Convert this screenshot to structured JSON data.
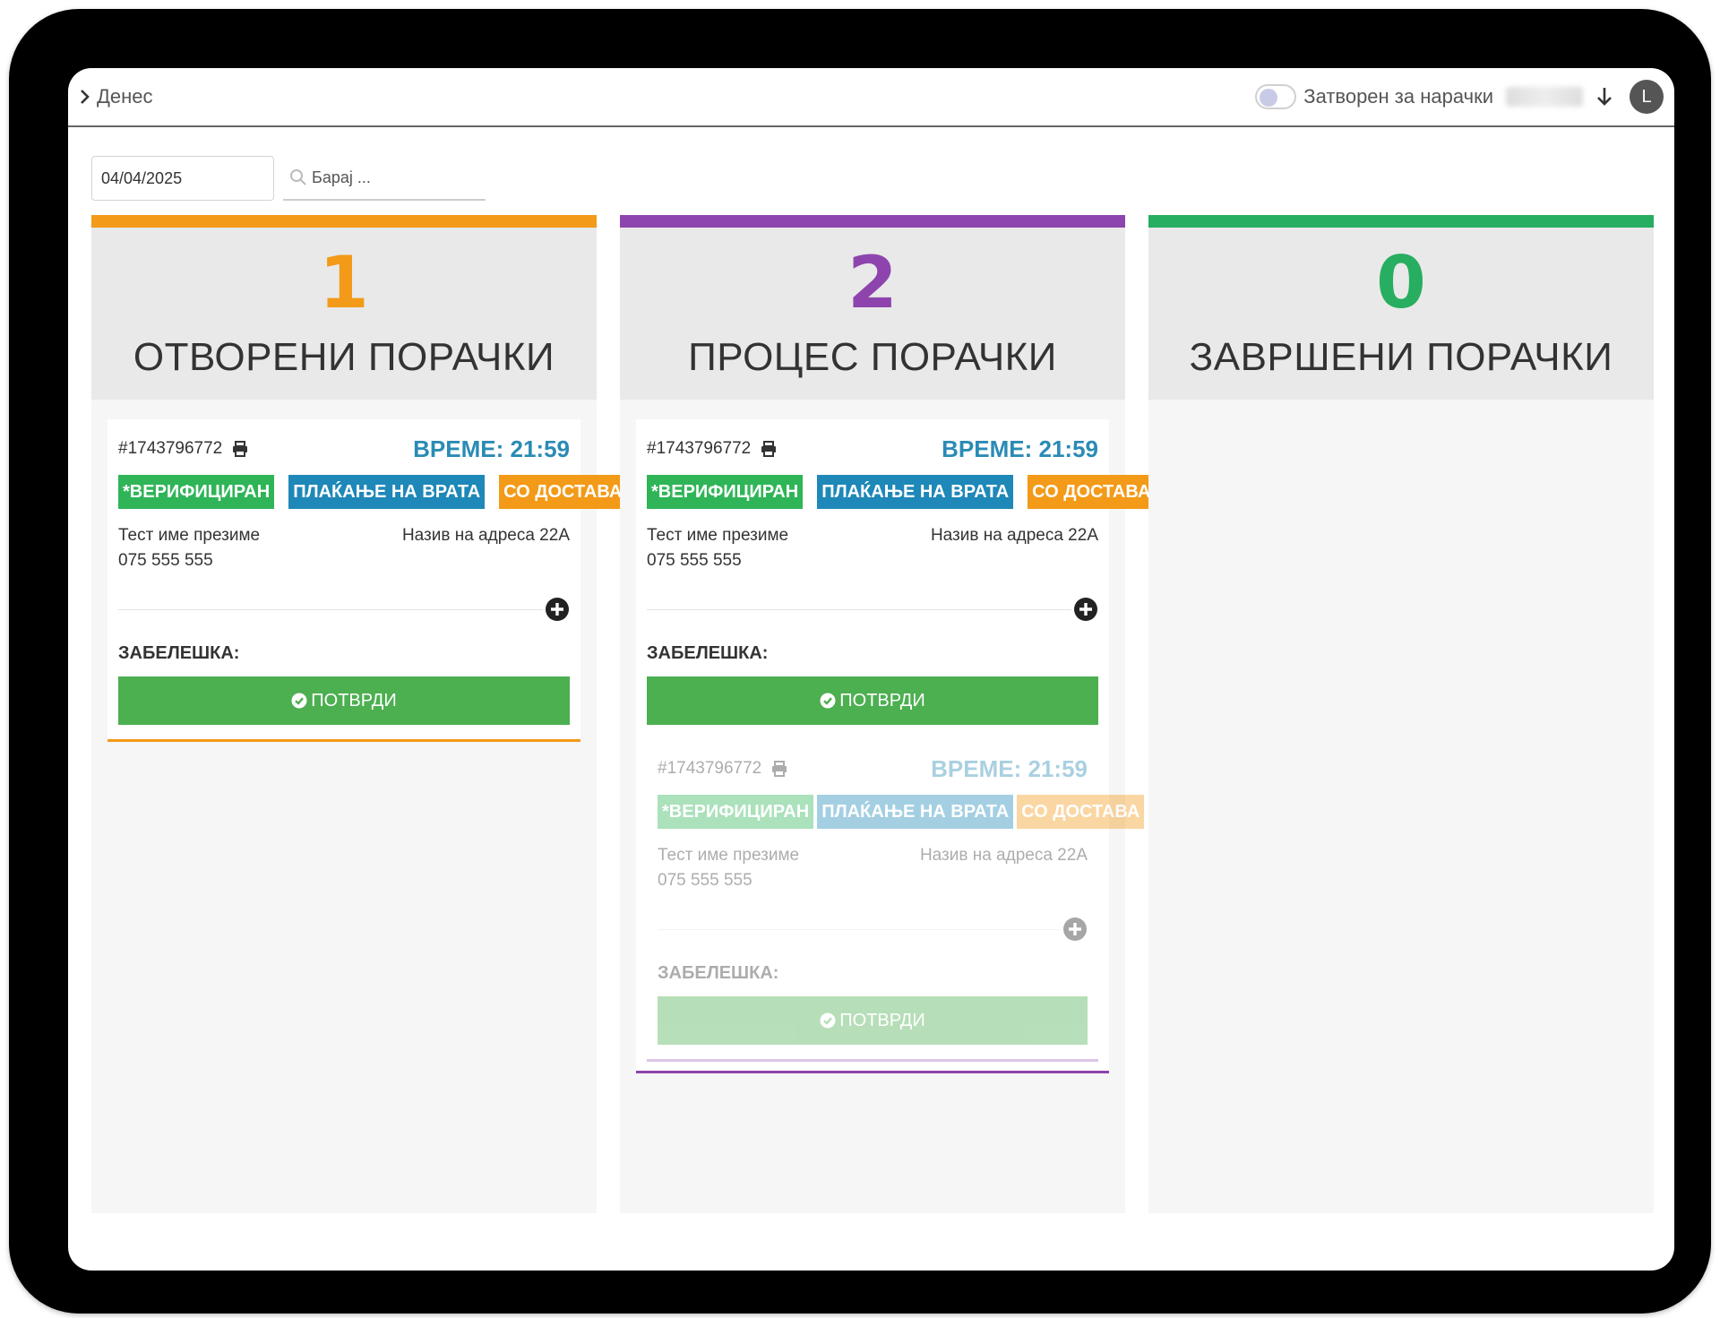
{
  "topbar": {
    "title": "Денес",
    "closed_label": "Затворен за нарачки",
    "avatar_letter": "L"
  },
  "filters": {
    "date_value": "04/04/2025",
    "search_placeholder": "Барај ..."
  },
  "columns": [
    {
      "count": "1",
      "title": "ОТВОРЕНИ ПОРАЧКИ",
      "color": "#f39a18"
    },
    {
      "count": "2",
      "title": "ПРОЦЕС ПОРАЧКИ",
      "color": "#8e44ad"
    },
    {
      "count": "0",
      "title": "ЗАВРШЕНИ ПОРАЧКИ",
      "color": "#27ae60"
    }
  ],
  "order": {
    "id": "#1743796772",
    "time": "ВРЕМЕ: 21:59",
    "badges": [
      "*ВЕРИФИЦИРАН",
      "ПЛАЌАЊЕ НА ВРАТА",
      "СО ДОСТАВА"
    ],
    "customer_name": "Тест име презиме",
    "phone": "075 555 555",
    "address": "Назив на адреса 22A",
    "note_label": "ЗАБЕЛЕШКА:",
    "confirm_label": "ПОТВРДИ"
  },
  "colors": {
    "badge_green": "#2fb558",
    "badge_blue": "#1e88b8",
    "badge_orange": "#f39a18",
    "confirm_green": "#4caf50",
    "time_blue": "#2a8bb5"
  }
}
